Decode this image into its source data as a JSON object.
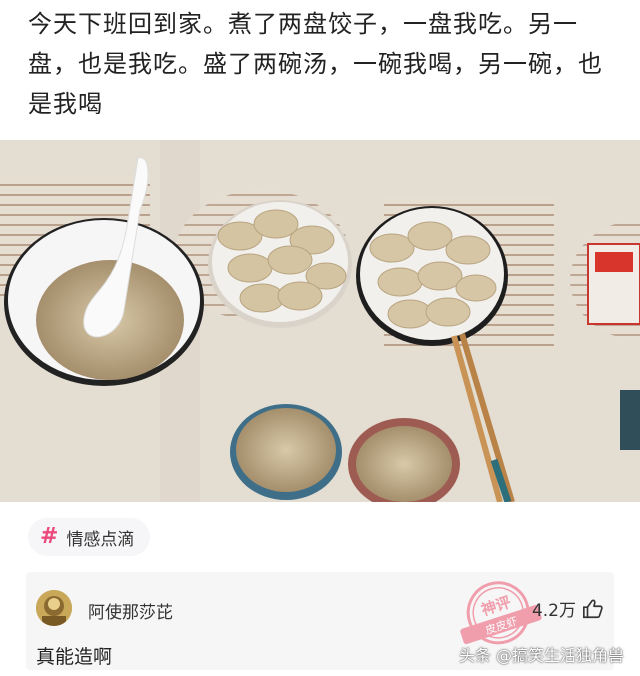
{
  "post": {
    "text": "今天下班回到家。煮了两盘饺子，一盘我吃。另一盘，也是我吃。盛了两碗汤，一碗我喝，另一碗，也是我喝"
  },
  "photo": {
    "icon": "photo-of-dumplings-and-soup"
  },
  "tag": {
    "icon": "hash-icon",
    "label": "情感点滴"
  },
  "comment": {
    "username": "阿使那莎芘",
    "likes": "4.2万",
    "text": "真能造啊",
    "stamp_line1": "神评",
    "stamp_line2": "皮皮虾"
  },
  "watermark": {
    "text": "头条 @搞笑生活独角兽"
  },
  "colors": {
    "accent": "#ec4a7d",
    "stamp": "#f08fa0",
    "card_bg": "#f6f6f7"
  }
}
